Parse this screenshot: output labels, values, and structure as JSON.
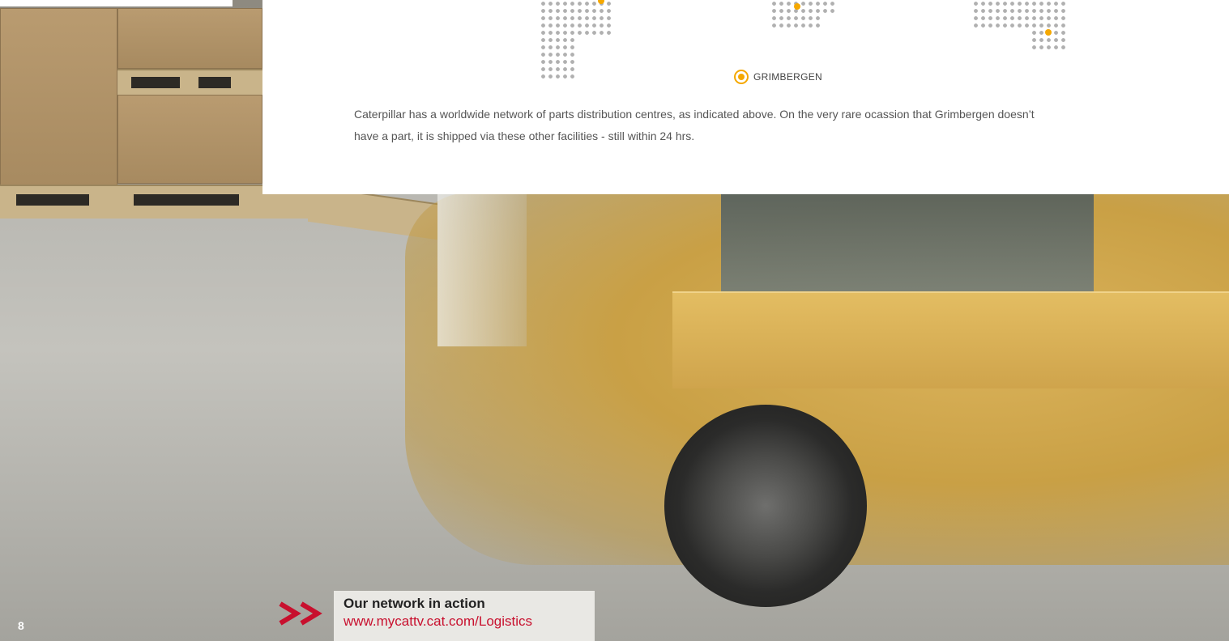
{
  "map": {
    "legend_label": "GRIMBERGEN",
    "marker_color": "#f5a800",
    "legend_icon": "location-dot-icon"
  },
  "caption": {
    "text": "Caterpillar has a worldwide network of parts distribution centres, as indicated above. On the very rare ocassion that Grimbergen doesn’t have a part, it is shipped via these other facilities - still within 24 hrs."
  },
  "page": {
    "number": "8"
  },
  "link": {
    "icon": "double-chevron-right-icon",
    "title": "Our network in action",
    "url": "www.mycattv.cat.com/Logistics",
    "accent_color": "#c8102e"
  }
}
